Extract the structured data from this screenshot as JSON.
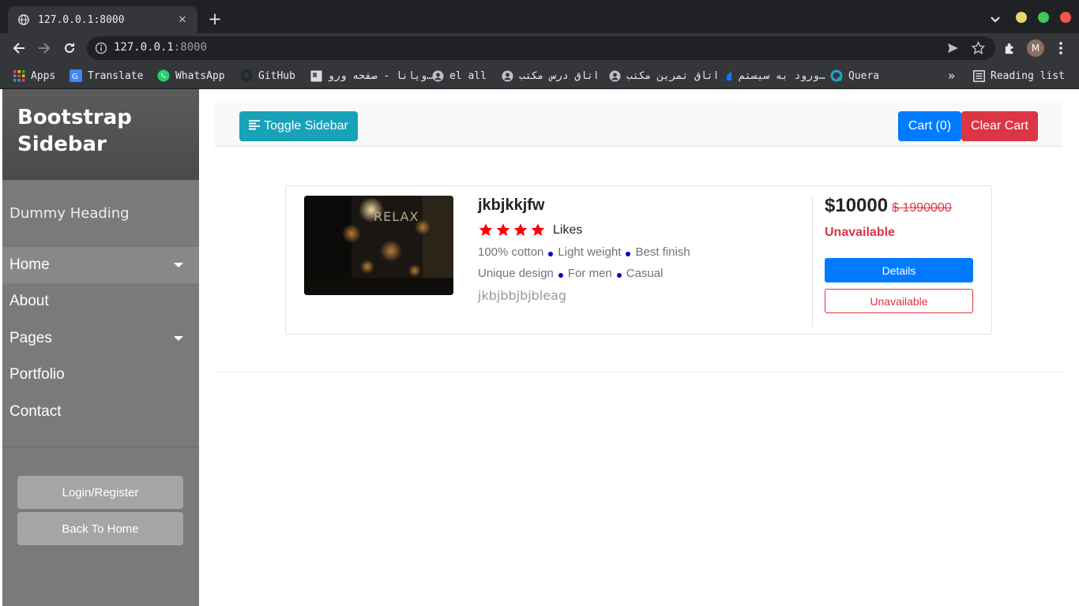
{
  "browser": {
    "tab_title": "127.0.0.1:8000",
    "url_host": "127.0.0.1",
    "url_port": ":8000",
    "profile_initial": "M",
    "bookmarks": [
      {
        "label": "Apps",
        "icon": "apps-grid-icon"
      },
      {
        "label": "Translate",
        "icon": "translate-icon"
      },
      {
        "label": "WhatsApp",
        "icon": "whatsapp-icon"
      },
      {
        "label": "GitHub",
        "icon": "github-icon"
      },
      {
        "label": "ویانا - صفحه ورو…",
        "icon": "page-icon"
      },
      {
        "label": "el all",
        "icon": "user-circle-icon"
      },
      {
        "label": "اتاق درس مکتب",
        "icon": "user-circle-icon"
      },
      {
        "label": "اتاق تمرین مکتب",
        "icon": "user-circle-icon"
      },
      {
        "label": "ورود به سیستم…",
        "icon": "site-icon"
      },
      {
        "label": "Quera",
        "icon": "quera-icon"
      }
    ],
    "overflow": "»",
    "reading_list": "Reading list"
  },
  "sidebar": {
    "title": "Bootstrap Sidebar",
    "heading": "Dummy Heading",
    "items": [
      {
        "label": "Home",
        "has_caret": true
      },
      {
        "label": "About",
        "has_caret": false
      },
      {
        "label": "Pages",
        "has_caret": true
      },
      {
        "label": "Portfolio",
        "has_caret": false
      },
      {
        "label": "Contact",
        "has_caret": false
      }
    ],
    "login_label": "Login/Register",
    "back_label": "Back To Home"
  },
  "navbar": {
    "toggle_label": "Toggle Sidebar",
    "cart_label": "Cart (0)",
    "clear_label": "Clear Cart"
  },
  "product": {
    "name": "jkbjkkjfw",
    "rating": 4,
    "likes_label": "Likes",
    "features_row1": [
      "100% cotton",
      "Light weight",
      "Best finish"
    ],
    "features_row2": [
      "Unique design",
      "For men",
      "Casual"
    ],
    "description": "jkbjbbjbjbleag",
    "price": "$10000",
    "old_price": "$ 1990000",
    "status": "Unavailable",
    "details_label": "Details",
    "unavailable_label": "Unavailable"
  },
  "colors": {
    "accent_teal": "#17a2b8",
    "primary_blue": "#007bff",
    "danger_red": "#dc3545",
    "star_red": "#ff0000",
    "sidebar_gray": "#7a7a7a"
  }
}
